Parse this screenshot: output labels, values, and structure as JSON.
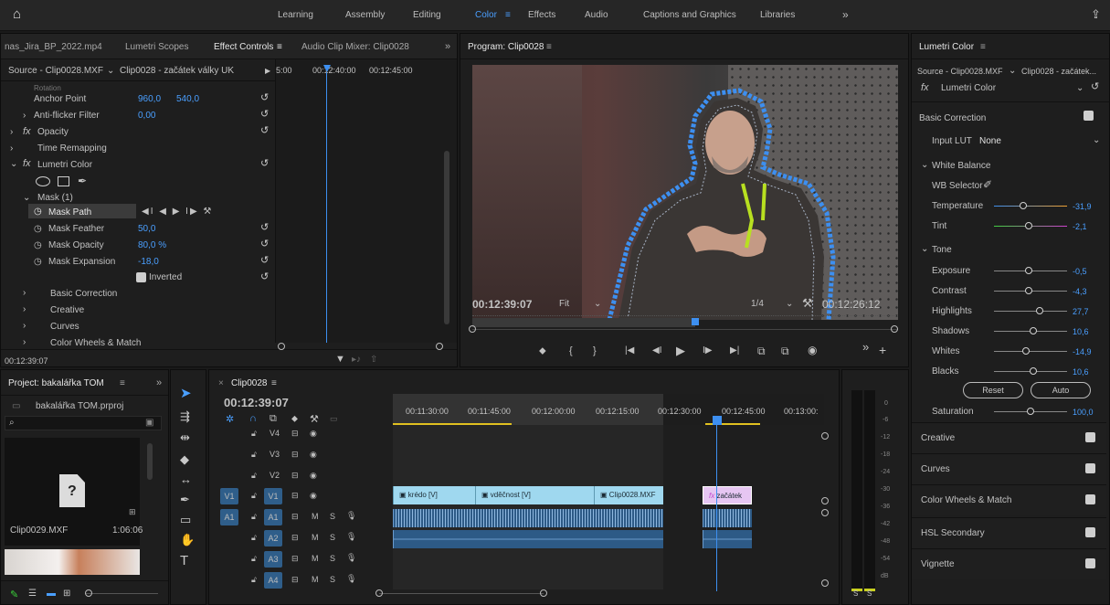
{
  "topbar": {
    "home": "⌂",
    "workspaces": [
      "Learning",
      "Assembly",
      "Editing",
      "Color",
      "Effects",
      "Audio",
      "Captions and Graphics",
      "Libraries"
    ],
    "active": "Color",
    "menu_icon": "≡",
    "more": "»",
    "share": "⇪"
  },
  "effect_controls": {
    "tabs": [
      "nas_Jira_BP_2022.mp4",
      "Lumetri Scopes",
      "Effect Controls",
      "Audio Clip Mixer: Clip0028"
    ],
    "tab_menu": "≡",
    "more": "»",
    "source_label": "Source - Clip0028.MXF",
    "source_clip": "Clip0028 - začátek války UK",
    "play": "▶",
    "ruler": [
      "5:00",
      "00:12:40:00",
      "00:12:45:00"
    ],
    "rows": {
      "rotation": "Rotation",
      "anchor_point": "Anchor Point",
      "anchor_x": "960,0",
      "anchor_y": "540,0",
      "anti_flicker": "Anti-flicker Filter",
      "anti_flicker_val": "0,00",
      "opacity": "Opacity",
      "time_remapping": "Time Remapping",
      "lumetri_color": "Lumetri Color",
      "mask": "Mask (1)",
      "mask_path": "Mask Path",
      "mask_path_controls": "◀I ◀ ▶ I▶ ⚒",
      "mask_feather": "Mask Feather",
      "mask_feather_val": "50,0",
      "mask_opacity": "Mask Opacity",
      "mask_opacity_val": "80,0 %",
      "mask_expansion": "Mask Expansion",
      "mask_expansion_val": "-18,0",
      "inverted": "Inverted",
      "basic_correction": "Basic Correction",
      "creative": "Creative",
      "curves": "Curves",
      "color_wheels": "Color Wheels & Match"
    },
    "fx": "fx",
    "timecode": "00:12:39:07"
  },
  "program": {
    "title": "Program: Clip0028",
    "menu": "≡",
    "timecode": "00:12:39:07",
    "fit": "Fit",
    "quality": "1/4",
    "duration": "00:12:26:12",
    "controls": [
      "⬥",
      "{",
      "}",
      "|◀",
      "◀I",
      "▶",
      "I▶",
      "▶|",
      "⧉",
      "⧉",
      "◉"
    ],
    "more": "»",
    "add": "+"
  },
  "project": {
    "title": "Project: bakalářka TOM",
    "menu": "≡",
    "more": "»",
    "file": "bakalářka TOM.prproj",
    "search_icon": "⌕",
    "clip_name": "Clip0029.MXF",
    "clip_duration": "1:06:06",
    "unknown": "?"
  },
  "timeline": {
    "title": "Clip0028",
    "menu": "≡",
    "close": "×",
    "timecode": "00:12:39:07",
    "ruler": [
      "00:11:30:00",
      "00:11:45:00",
      "00:12:00:00",
      "00:12:15:00",
      "00:12:30:00",
      "00:12:45:00",
      "00:13:00:"
    ],
    "video_tracks": [
      "V4",
      "V3",
      "V2",
      "V1"
    ],
    "audio_tracks": [
      "A1",
      "A2",
      "A3",
      "A4"
    ],
    "source_v": "V1",
    "source_a": "A1",
    "m": "M",
    "s": "S",
    "clips": [
      "krédo [V]",
      "vděčnost [V]",
      "Clip0028.MXF",
      "začátek"
    ],
    "clip_fx": "fx",
    "meter_scale": [
      "0",
      "-6",
      "-12",
      "-18",
      "-24",
      "-30",
      "-36",
      "-42",
      "-48",
      "-54",
      "dB"
    ],
    "meter_solo": [
      "S",
      "S"
    ]
  },
  "lumetri": {
    "title": "Lumetri Color",
    "menu": "≡",
    "source_label": "Source - Clip0028.MXF",
    "source_clip": "Clip0028 - začátek...",
    "fx": "fx",
    "effect": "Lumetri Color",
    "basic_correction": "Basic Correction",
    "input_lut_label": "Input LUT",
    "input_lut_value": "None",
    "white_balance": "White Balance",
    "wb_selector": "WB Selector",
    "temperature": "Temperature",
    "temperature_val": "-31,9",
    "temperature_pos": 0.4,
    "tint": "Tint",
    "tint_val": "-2,1",
    "tint_pos": 0.48,
    "tone": "Tone",
    "exposure": "Exposure",
    "exposure_val": "-0,5",
    "exposure_pos": 0.48,
    "contrast": "Contrast",
    "contrast_val": "-4,3",
    "contrast_pos": 0.48,
    "highlights": "Highlights",
    "highlights_val": "27,7",
    "highlights_pos": 0.63,
    "shadows": "Shadows",
    "shadows_val": "10,6",
    "shadows_pos": 0.54,
    "whites": "Whites",
    "whites_val": "-14,9",
    "whites_pos": 0.44,
    "blacks": "Blacks",
    "blacks_val": "10,6",
    "blacks_pos": 0.54,
    "reset": "Reset",
    "auto": "Auto",
    "saturation": "Saturation",
    "saturation_val": "100,0",
    "saturation_pos": 0.5,
    "sections": [
      "Creative",
      "Curves",
      "Color Wheels & Match",
      "HSL Secondary",
      "Vignette"
    ],
    "check": "✓"
  },
  "colors": {
    "accent": "#4a9fff",
    "clip": "#9fd8ef",
    "audio": "#2d5a86",
    "mask": "#3d8ff0",
    "playhead": "#3d8ff0"
  }
}
